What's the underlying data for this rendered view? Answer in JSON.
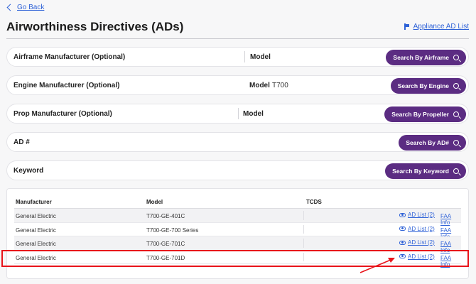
{
  "nav": {
    "go_back": "Go Back"
  },
  "header": {
    "title": "Airworthiness Directives (ADs)",
    "appliance_link": "Appliance AD List"
  },
  "searches": {
    "airframe": {
      "label": "Airframe Manufacturer (Optional)",
      "model_label": "Model",
      "model_value": "",
      "button": "Search By Airframe"
    },
    "engine": {
      "label": "Engine Manufacturer (Optional)",
      "model_label": "Model",
      "model_value": "T700",
      "button": "Search By Engine"
    },
    "prop": {
      "label": "Prop Manufacturer (Optional)",
      "model_label": "Model",
      "model_value": "",
      "button": "Search By Propeller"
    },
    "ad": {
      "label": "AD #",
      "button": "Search By AD#"
    },
    "keyword": {
      "label": "Keyword",
      "button": "Search By Keyword"
    }
  },
  "table": {
    "headers": {
      "manufacturer": "Manufacturer",
      "model": "Model",
      "tcds": "TCDS"
    },
    "rows": [
      {
        "manufacturer": "General Electric",
        "model": "T700-GE-401C",
        "tcds": "",
        "ad_list": "AD List (2)",
        "faa": "FAA Info"
      },
      {
        "manufacturer": "General Electric",
        "model": "T700-GE-700 Series",
        "tcds": "",
        "ad_list": "AD List (2)",
        "faa": "FAA Info"
      },
      {
        "manufacturer": "General Electric",
        "model": "T700-GE-701C",
        "tcds": "",
        "ad_list": "AD List (2)",
        "faa": "FAA Info"
      },
      {
        "manufacturer": "General Electric",
        "model": "T700-GE-701D",
        "tcds": "",
        "ad_list": "AD List (2)",
        "faa": "FAA Info"
      }
    ]
  },
  "colors": {
    "accent": "#5b2c82",
    "link": "#2f62d7",
    "annotation": "#e8141b"
  },
  "icons": {
    "back": "chevron-left-icon",
    "appliance": "flag-icon",
    "search": "search-icon",
    "view": "eye-icon"
  }
}
